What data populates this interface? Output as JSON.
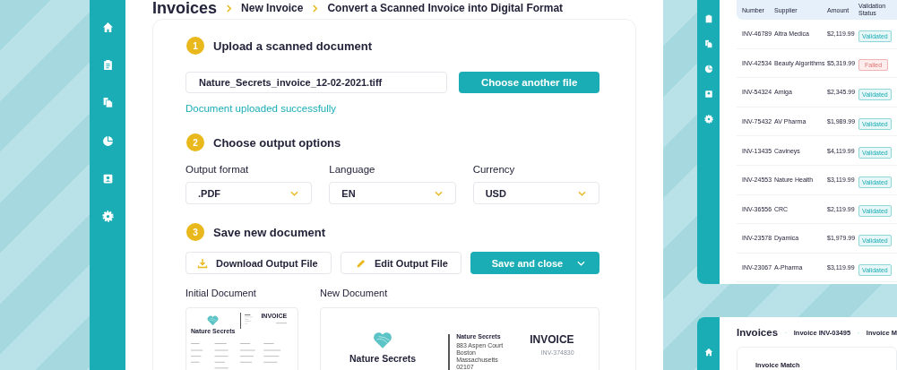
{
  "main_window": {
    "breadcrumb": [
      {
        "label": "Invoices"
      },
      {
        "label": "New Invoice"
      },
      {
        "label": "Convert a Scanned Invoice into Digital Format"
      }
    ],
    "steps": [
      {
        "number": "1",
        "title": "Upload a scanned document"
      },
      {
        "number": "2",
        "title": "Choose output options"
      },
      {
        "number": "3",
        "title": "Save new document"
      }
    ],
    "upload": {
      "file_name": "Nature_Secrets_invoice_12-02-2021.tiff",
      "button": "Choose another file",
      "status": "Document uploaded successfully"
    },
    "options": [
      {
        "label": "Output format",
        "value": ".PDF"
      },
      {
        "label": "Language",
        "value": "EN"
      },
      {
        "label": "Currency",
        "value": "USD"
      }
    ],
    "actions": [
      {
        "kind": "download",
        "label": "Download Output File"
      },
      {
        "kind": "edit",
        "label": "Edit Output File"
      },
      {
        "kind": "primary",
        "label": "Save and close"
      }
    ],
    "documents": {
      "initial": {
        "label": "Initial Document",
        "company": "Nature Secrets",
        "title": "INVOICE"
      },
      "new": {
        "label": "New Document",
        "company": "Nature Secrets",
        "sender": "Nature Secrets",
        "address": [
          "883 Aspen Court",
          "Boston",
          "Massachusetts",
          "02107"
        ],
        "title": "INVOICE",
        "number": "INV-374830"
      }
    }
  },
  "invoice_table": {
    "columns": [
      "Number",
      "Supplier",
      "Amount",
      "Validation Status"
    ],
    "rows": [
      {
        "number": "INV-46789",
        "supplier": "Altra Medica",
        "amount": "$2,119.99",
        "status": {
          "label": "Validated",
          "kind": "validated"
        }
      },
      {
        "number": "INV-42534",
        "supplier": "Beauty Algorithms",
        "amount": "$5,319.99",
        "status": {
          "label": "Failed",
          "kind": "failed"
        }
      },
      {
        "number": "INV-54324",
        "supplier": "Amiga",
        "amount": "$2,345.99",
        "status": {
          "label": "Validated",
          "kind": "validated"
        }
      },
      {
        "number": "INV-75432",
        "supplier": "AV Pharma",
        "amount": "$1,989.99",
        "status": {
          "label": "Validated",
          "kind": "validated"
        }
      },
      {
        "number": "INV-13435",
        "supplier": "Cavineys",
        "amount": "$4,119.99",
        "status": {
          "label": "Validated",
          "kind": "validated"
        }
      },
      {
        "number": "INV-24553",
        "supplier": "Nature Health",
        "amount": "$3,119.99",
        "status": {
          "label": "Validated",
          "kind": "validated"
        }
      },
      {
        "number": "INV-36556",
        "supplier": "CRC",
        "amount": "$2,119.99",
        "status": {
          "label": "Validated",
          "kind": "validated"
        }
      },
      {
        "number": "INV-23578",
        "supplier": "Dyamica",
        "amount": "$1,979.99",
        "status": {
          "label": "Validated",
          "kind": "validated"
        }
      },
      {
        "number": "INV-23067",
        "supplier": "A-Pharma",
        "amount": "$3,119.99",
        "status": {
          "label": "Validated",
          "kind": "validated"
        }
      }
    ]
  },
  "match_window": {
    "breadcrumb": [
      {
        "label": "Invoices"
      },
      {
        "label": "Invoice INV-03495"
      },
      {
        "label": "Invoice M"
      }
    ],
    "panel_title": "Invoice Match"
  }
}
